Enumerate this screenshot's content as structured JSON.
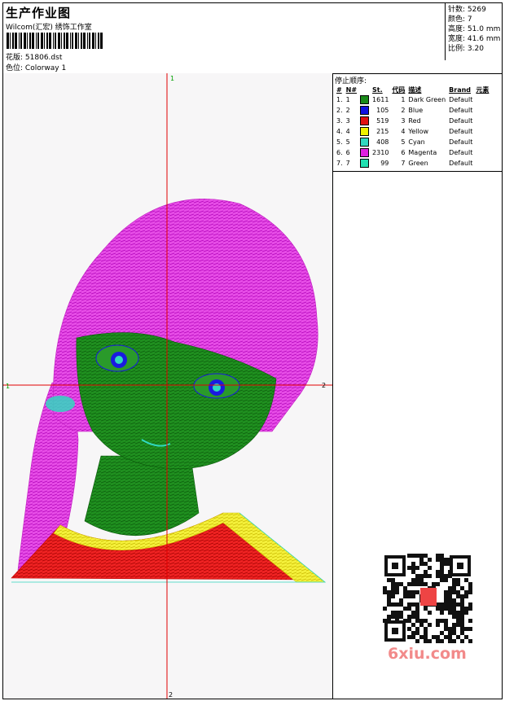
{
  "header": {
    "title": "生产作业图",
    "company": "Wilcom(汇宏) 绣饰工作室",
    "design_label": "花版:",
    "design_file": "51806.dst",
    "colorway_label": "色位:",
    "colorway": "Colorway 1"
  },
  "stats": [
    {
      "label": "针数:",
      "value": "5269"
    },
    {
      "label": "颜色:",
      "value": "7"
    },
    {
      "label": "高度:",
      "value": "51.0 mm"
    },
    {
      "label": "宽度:",
      "value": "41.6 mm"
    },
    {
      "label": "比例:",
      "value": "3.20"
    }
  ],
  "stop_sequence": {
    "title": "停止顺序:",
    "columns": [
      "#",
      "N#",
      "St.",
      "代码",
      "描述",
      "Brand",
      "元素"
    ],
    "rows": [
      {
        "idx": "1.",
        "n": "1",
        "color": "#1a8a1a",
        "stitches": "1611",
        "code": "1",
        "desc": "Dark Green",
        "brand": "Default",
        "element": ""
      },
      {
        "idx": "2.",
        "n": "2",
        "color": "#1010e0",
        "stitches": "105",
        "code": "2",
        "desc": "Blue",
        "brand": "Default",
        "element": ""
      },
      {
        "idx": "3.",
        "n": "3",
        "color": "#e01010",
        "stitches": "519",
        "code": "3",
        "desc": "Red",
        "brand": "Default",
        "element": ""
      },
      {
        "idx": "4.",
        "n": "4",
        "color": "#f0f000",
        "stitches": "215",
        "code": "4",
        "desc": "Yellow",
        "brand": "Default",
        "element": ""
      },
      {
        "idx": "5.",
        "n": "5",
        "color": "#30d8c0",
        "stitches": "408",
        "code": "5",
        "desc": "Cyan",
        "brand": "Default",
        "element": ""
      },
      {
        "idx": "6.",
        "n": "6",
        "color": "#e020e0",
        "stitches": "2310",
        "code": "6",
        "desc": "Magenta",
        "brand": "Default",
        "element": ""
      },
      {
        "idx": "7.",
        "n": "7",
        "color": "#20e0b0",
        "stitches": "99",
        "code": "7",
        "desc": "Green",
        "brand": "Default",
        "element": ""
      }
    ]
  },
  "axes": {
    "top": "1",
    "left": "1",
    "right": "2",
    "bottom": "2"
  },
  "watermark": "6xiu.com",
  "colors": {
    "crosshair": "#e00000",
    "axis_label": "#00a000"
  }
}
